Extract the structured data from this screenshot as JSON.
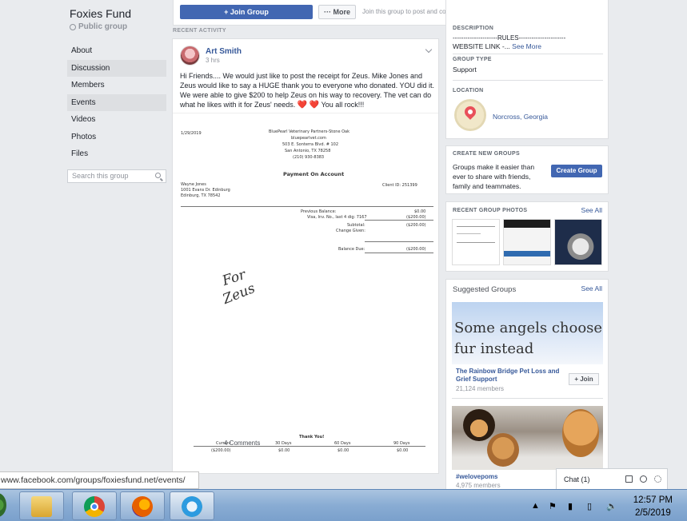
{
  "group": {
    "name": "Foxies Fund",
    "privacy": "Public group"
  },
  "nav": [
    "About",
    "Discussion",
    "Members",
    "Events",
    "Videos",
    "Photos",
    "Files"
  ],
  "search_placeholder": "Search this group",
  "topbar": {
    "join": "+ Join Group",
    "more": "··· More",
    "hint": "Join this group to post and comment."
  },
  "recent_activity_label": "RECENT ACTIVITY",
  "post": {
    "author": "Art Smith",
    "time": "3 hrs",
    "text": "Hi Friends.... We would just like to post the receipt for Zeus. Mike Jones and Zeus would like to say a HUGE thank you to everyone who donated. YOU did it. We were able to give $200 to help Zeus on his way to recovery. The vet can do what he likes with it for Zeus' needs.",
    "text_end": "You all rock!!!",
    "comments": "4 Comments"
  },
  "receipt": {
    "date": "1/29/2019",
    "clinic": "BluePearl Veterinary Partners-Stone Oak",
    "site": "bluepearlvet.com",
    "address1": "503 E. Sonterra Blvd. # 102",
    "address2": "San Antonio, TX 78258",
    "phone": "(210) 930-8383",
    "title": "Payment On Account",
    "client_name": "Wayne Jones",
    "client_addr1": "1001 Evans Dr. Edinburg",
    "client_addr2": "Edinburg, TX 78542",
    "client_id": "Client ID: 251399",
    "prev_balance_label": "Previous Balance:",
    "prev_balance": "$0.00",
    "visa_label": "Visa, Inv. No., last 4 dig: 7167",
    "visa_amount": "($200.00)",
    "subtotal_label": "Subtotal:",
    "subtotal": "($200.00)",
    "change_label": "Change Given:",
    "balance_label": "Balance Due:",
    "balance": "($200.00)",
    "handwriting_1": "For",
    "handwriting_2": "Zeus",
    "thanks": "Thank You!",
    "aging_headers": [
      "Current",
      "30 Days",
      "60 Days",
      "90 Days"
    ],
    "aging_values": [
      "($200.00)",
      "$0.00",
      "$0.00",
      "$0.00"
    ]
  },
  "about": {
    "description_label": "DESCRIPTION",
    "description_line1": "---------------------RULES----------------------",
    "description_line2": "WEBSITE LINK -...",
    "see_more": "See More",
    "type_label": "GROUP TYPE",
    "type": "Support",
    "location_label": "LOCATION",
    "location": "Norcross, Georgia"
  },
  "create_group": {
    "label": "CREATE NEW GROUPS",
    "text": "Groups make it easier than ever to share with friends, family and teammates.",
    "button": "Create Group"
  },
  "recent_photos": {
    "label": "RECENT GROUP PHOTOS",
    "see_all": "See All"
  },
  "suggested": {
    "label": "Suggested Groups",
    "see_all": "See All",
    "items": [
      {
        "image_text": "Some angels choose fur instead",
        "name": "The Rainbow Bridge Pet Loss and Grief Support",
        "members": "21,124 members",
        "join": "+ Join"
      },
      {
        "name": "#welovepoms",
        "members": "4,975 members"
      }
    ]
  },
  "chat": {
    "label": "Chat (1)"
  },
  "status_url": "www.facebook.com/groups/foxiesfund.net/events/",
  "taskbar": {
    "time": "12:57 PM",
    "date": "2/5/2019"
  },
  "colors": {
    "fb_blue": "#4267b2",
    "link": "#365899",
    "bg": "#e9ebee"
  }
}
